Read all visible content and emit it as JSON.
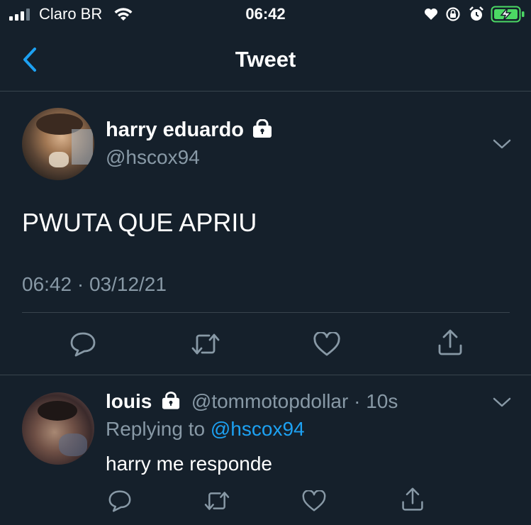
{
  "status": {
    "carrier": "Claro BR",
    "time": "06:42"
  },
  "nav": {
    "title": "Tweet"
  },
  "tweet": {
    "display_name": "harry eduardo",
    "handle": "@hscox94",
    "text": "PWUTA QUE APRIU",
    "timestamp": "06:42 · 03/12/21"
  },
  "reply": {
    "display_name": "louis",
    "handle": "@tommotopdollar",
    "separator": "·",
    "age": "10s",
    "replying_to_prefix": "Replying to",
    "replying_to_handle": "@hscox94",
    "text": "harry me responde"
  },
  "colors": {
    "background": "#15202b",
    "accent": "#1da1f2",
    "muted": "#8899a6",
    "divider": "#38444d",
    "battery": "#4cd964"
  },
  "icons": [
    "signal-icon",
    "wifi-icon",
    "heart-status-icon",
    "orientation-lock-icon",
    "alarm-icon",
    "battery-charging-icon",
    "back-chevron-icon",
    "lock-icon",
    "chevron-down-icon",
    "reply-icon",
    "retweet-icon",
    "like-icon",
    "share-icon"
  ]
}
